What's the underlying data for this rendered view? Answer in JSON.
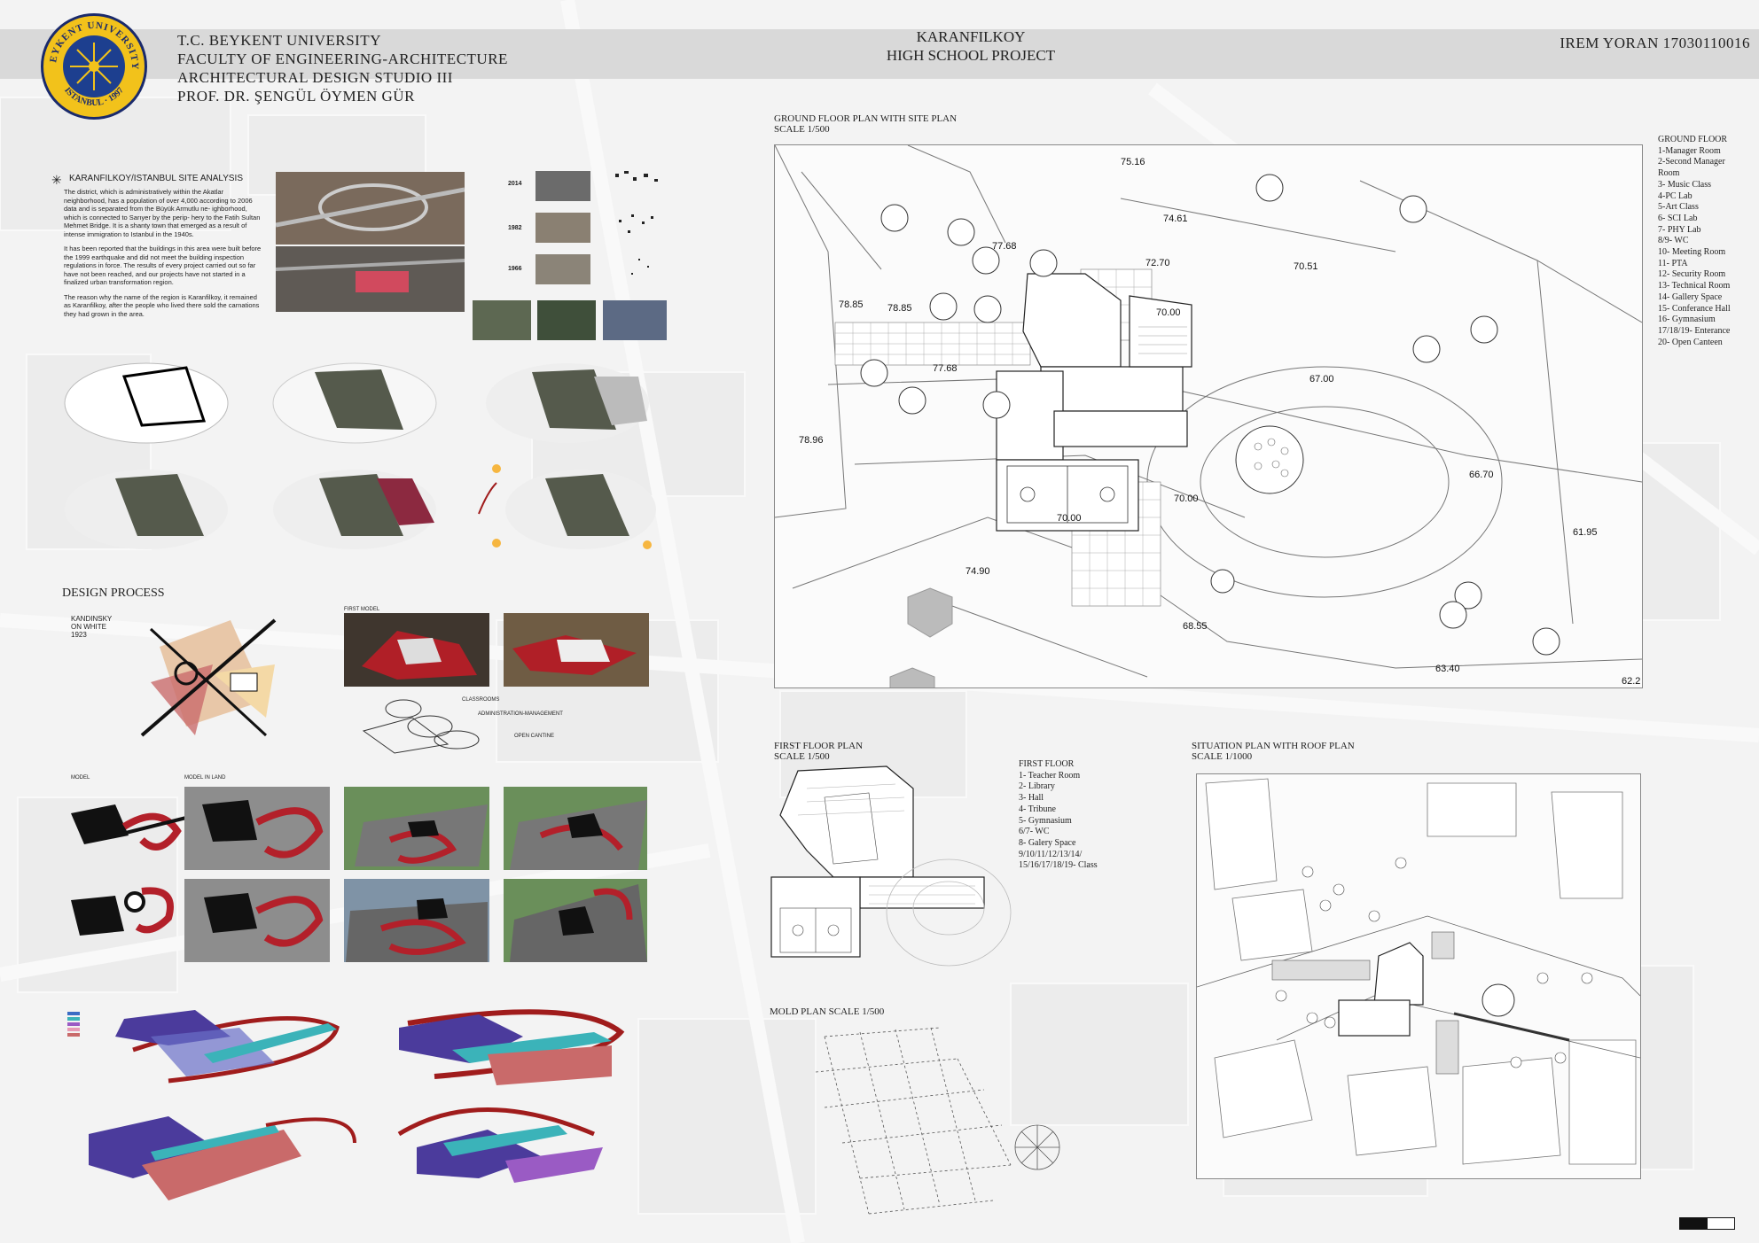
{
  "header": {
    "university_lines": [
      "T.C. BEYKENT UNIVERSITY",
      "FACULTY OF ENGINEERING-ARCHITECTURE",
      "ARCHITECTURAL DESIGN STUDIO III",
      "PROF. DR. ŞENGÜL ÖYMEN GÜR"
    ],
    "project_title": [
      "KARANFILKOY",
      "HIGH SCHOOL PROJECT"
    ],
    "student": "IREM YORAN 17030110016",
    "logo_text": [
      "BEYKENT UNIVERSITY",
      "ISTANBUL · 1997"
    ]
  },
  "site_analysis": {
    "title": "KARANFILKOY/ISTANBUL SITE ANALYSIS",
    "paragraphs": [
      "The district, which is administratively within the Akatlar neighborhood, has a population of over 4,000 according to 2006 data and is separated from the Büyük Armutlu ne- ighborhood, which is connected to Sarıyer by the perip- hery to the Fatih Sultan Mehmet Bridge. It is a shanty town that emerged as a result of intense immigration to Istanbul in the 1940s.",
      "It has been reported that the buildings in this area were built before the 1999 earthquake and did not meet the building inspection regulations in force. The results of every project carried out so far have not been reached, and our projects have not started in a finalized urban transformation region.",
      "The reason why the name of the region is Karanfilkoy, it remained as Karanfilkoy, after the people who lived there sold the carnations they had grown in the area."
    ],
    "years": [
      "2014",
      "1982",
      "1966"
    ]
  },
  "design_process": {
    "title": "DESIGN PROCESS",
    "kandinsky": [
      "KANDINSKY",
      "ON WHITE",
      "1923"
    ],
    "first_model": "FIRST MODEL",
    "diagram_labels": [
      "CLASSROOMS",
      "ADMINISTRATION-MANAGEMENT",
      "OPEN CANTINE"
    ],
    "model": "MODEL",
    "model_in_land": "MODEL IN LAND"
  },
  "ground_floor": {
    "title": "GROUND FLOOR PLAN WITH SITE PLAN",
    "scale": "SCALE 1/500",
    "elevations": [
      "75.16",
      "74.61",
      "77.68",
      "72.70",
      "70.51",
      "78.85",
      "78.85",
      "70.00",
      "77.68",
      "67.00",
      "78.96",
      "66.70",
      "70.00",
      "70.00",
      "61.95",
      "74.90",
      "68.55",
      "63.40",
      "62.2"
    ]
  },
  "ground_floor_legend": {
    "title": "GROUND FLOOR",
    "items": [
      "1-Manager Room",
      "2-Second Manager",
      "Room",
      "3- Music Class",
      "4-PC Lab",
      "5-Art Class",
      "6- SCI Lab",
      "7- PHY Lab",
      "8/9- WC",
      "10- Meeting Room",
      "11- PTA",
      "12- Security Room",
      "13- Technical Room",
      "14- Gallery Space",
      "15- Conferance Hall",
      "16- Gymnasium",
      "17/18/19- Enterance",
      "20- Open Canteen"
    ]
  },
  "first_floor": {
    "title": "FIRST FLOOR PLAN",
    "scale": "SCALE 1/500",
    "legend_title": "FIRST FLOOR",
    "legend_items": [
      "1- Teacher Room",
      "2- Library",
      "3- Hall",
      "4- Tribune",
      "5- Gymnasium",
      "6/7- WC",
      "8- Galery Space",
      "9/10/11/12/13/14/",
      "15/16/17/18/19- Class"
    ]
  },
  "mold_plan": {
    "title": "MOLD PLAN SCALE 1/500"
  },
  "situation_plan": {
    "title": "SITUATION PLAN WITH ROOF PLAN",
    "scale": "SCALE 1/1000"
  },
  "colors": {
    "header_bar": "#d9d9d9",
    "logo_yellow": "#f2c21b",
    "logo_blue": "#1d3f8f",
    "model_red": "#b3202a",
    "model_black": "#111111",
    "axon_purple": "#4b3b9c",
    "axon_teal": "#3bb3b9",
    "axon_salmon": "#c96a6a"
  }
}
